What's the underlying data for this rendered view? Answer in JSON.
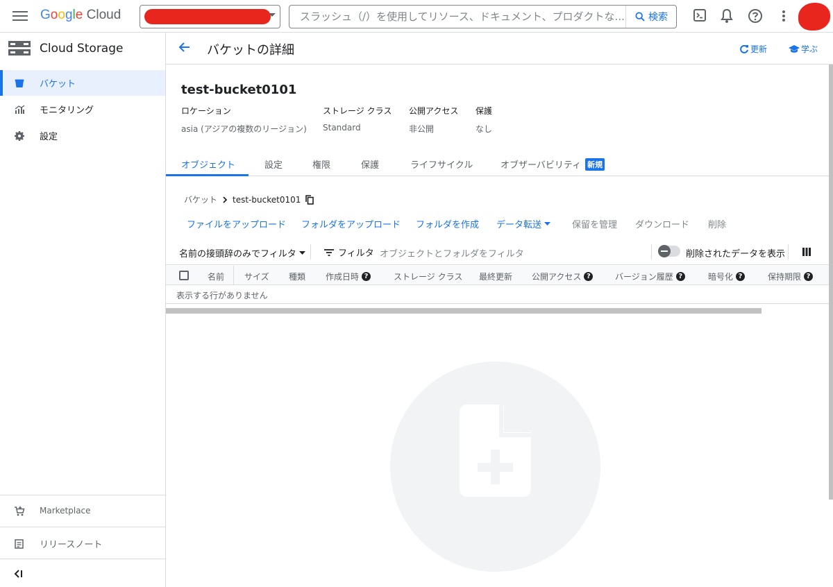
{
  "topbar": {
    "brand": "Google Cloud",
    "search_placeholder": "スラッシュ（/）を使用してリソース、ドキュメント、プロダクトな...",
    "search_button": "検索"
  },
  "sidebar": {
    "product": "Cloud Storage",
    "items": [
      {
        "label": "バケット",
        "icon": "bucket-icon",
        "active": true
      },
      {
        "label": "モニタリング",
        "icon": "monitoring-icon",
        "active": false
      },
      {
        "label": "設定",
        "icon": "gear-icon",
        "active": false
      }
    ],
    "bottom": [
      {
        "label": "Marketplace",
        "icon": "cart-icon"
      },
      {
        "label": "リリースノート",
        "icon": "notes-icon"
      }
    ]
  },
  "header": {
    "title": "バケットの詳細",
    "refresh": "更新",
    "learn": "学ぶ"
  },
  "bucket": {
    "name": "test-bucket0101",
    "meta": [
      {
        "key": "ロケーション",
        "value": "asia (アジアの複数のリージョン)"
      },
      {
        "key": "ストレージ クラス",
        "value": "Standard"
      },
      {
        "key": "公開アクセス",
        "value": "非公開"
      },
      {
        "key": "保護",
        "value": "なし"
      }
    ]
  },
  "tabs": [
    {
      "label": "オブジェクト",
      "active": true
    },
    {
      "label": "設定"
    },
    {
      "label": "権限"
    },
    {
      "label": "保護"
    },
    {
      "label": "ライフサイクル"
    },
    {
      "label": "オブザーバビリティ",
      "badge": "新規"
    }
  ],
  "breadcrumb": {
    "root": "バケット",
    "current": "test-bucket0101"
  },
  "actions": [
    {
      "label": "ファイルをアップロード",
      "enabled": true
    },
    {
      "label": "フォルダをアップロード",
      "enabled": true
    },
    {
      "label": "フォルダを作成",
      "enabled": true
    },
    {
      "label": "データ転送",
      "enabled": true,
      "dropdown": true
    },
    {
      "label": "保留を管理",
      "enabled": false
    },
    {
      "label": "ダウンロード",
      "enabled": false
    },
    {
      "label": "削除",
      "enabled": false
    }
  ],
  "filterbar": {
    "prefix_filter": "名前の接頭辞のみでフィルタ",
    "filter_label": "フィルタ",
    "filter_placeholder": "オブジェクトとフォルダをフィルタ",
    "show_deleted": "削除されたデータを表示"
  },
  "table": {
    "columns": [
      {
        "label": "名前"
      },
      {
        "label": "サイズ"
      },
      {
        "label": "種類"
      },
      {
        "label": "作成日時",
        "help": true
      },
      {
        "label": "ストレージ クラス"
      },
      {
        "label": "最終更新"
      },
      {
        "label": "公開アクセス",
        "help": true
      },
      {
        "label": "バージョン履歴",
        "help": true
      },
      {
        "label": "暗号化",
        "help": true
      },
      {
        "label": "保持期限",
        "help": true
      }
    ],
    "empty_text": "表示する行がありません"
  },
  "colors": {
    "accent": "#1a73e8",
    "redaction": "#e8261d",
    "border": "#dadce0"
  }
}
